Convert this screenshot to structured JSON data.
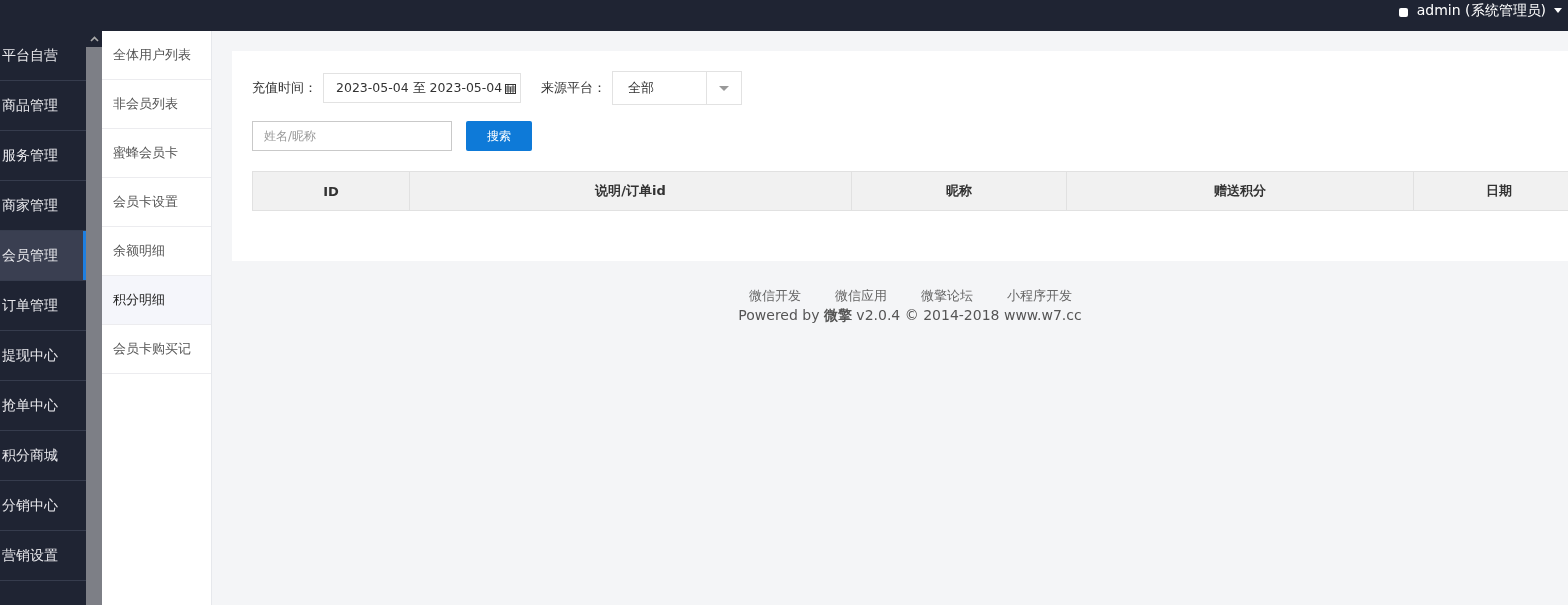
{
  "header": {
    "user": "admin (系统管理员)"
  },
  "sidebar": {
    "items": [
      {
        "label": "平台自营",
        "selected": false
      },
      {
        "label": "商品管理",
        "selected": false
      },
      {
        "label": "服务管理",
        "selected": false
      },
      {
        "label": "商家管理",
        "selected": false
      },
      {
        "label": "会员管理",
        "selected": true
      },
      {
        "label": "订单管理",
        "selected": false
      },
      {
        "label": "提现中心",
        "selected": false
      },
      {
        "label": "抢单中心",
        "selected": false
      },
      {
        "label": "积分商城",
        "selected": false
      },
      {
        "label": "分销中心",
        "selected": false
      },
      {
        "label": "营销设置",
        "selected": false
      }
    ]
  },
  "submenu": {
    "items": [
      {
        "label": "全体用户列表",
        "selected": false
      },
      {
        "label": "非会员列表",
        "selected": false
      },
      {
        "label": "蜜蜂会员卡",
        "selected": false
      },
      {
        "label": "会员卡设置",
        "selected": false
      },
      {
        "label": "余额明细",
        "selected": false
      },
      {
        "label": "积分明细",
        "selected": true
      },
      {
        "label": "会员卡购买记",
        "selected": false
      }
    ]
  },
  "filters": {
    "date_label": "充值时间：",
    "date_range": "2023-05-04 至 2023-05-04",
    "platform_label": "来源平台：",
    "platform_value": "全部",
    "search_placeholder": "姓名/昵称",
    "search_button": "搜索"
  },
  "table": {
    "columns": [
      "ID",
      "说明/订单id",
      "昵称",
      "赠送积分",
      "日期"
    ]
  },
  "footer": {
    "links": [
      "微信开发",
      "微信应用",
      "微擎论坛",
      "小程序开发"
    ],
    "copyright": "Powered by **微擎** v2.0.4 © 2014-2018 www.w7.cc"
  }
}
